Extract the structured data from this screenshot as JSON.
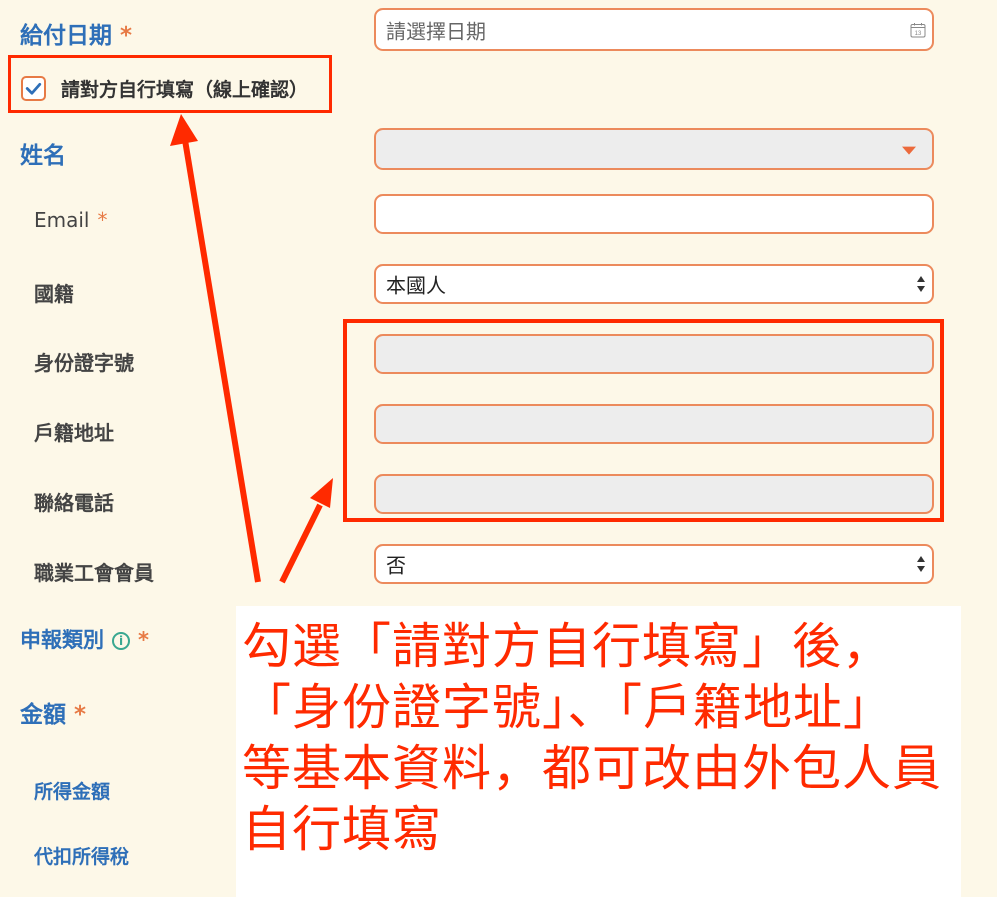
{
  "form": {
    "pay_date": {
      "label": "給付日期",
      "required": "*",
      "placeholder": "請選擇日期",
      "cal_day": "13"
    },
    "self_fill": {
      "label": "請對方自行填寫（線上確認）",
      "checked": true
    },
    "name": {
      "label": "姓名"
    },
    "email": {
      "label": "Email",
      "required": "*"
    },
    "nationality": {
      "label": "國籍",
      "value": "本國人"
    },
    "id_number": {
      "label": "身份證字號"
    },
    "address": {
      "label": "戶籍地址"
    },
    "phone": {
      "label": "聯絡電話"
    },
    "union_member": {
      "label": "職業工會會員",
      "value": "否"
    },
    "report_type": {
      "label": "申報類別",
      "required": "*"
    },
    "amount": {
      "label": "金額",
      "required": "*"
    },
    "income_amount": {
      "label": "所得金額"
    },
    "withholding_tax": {
      "label": "代扣所得稅"
    }
  },
  "annotation": {
    "text": "勾選「請對方自行填寫」後，「身份證字號」、「戶籍地址」等基本資料，都可改由外包人員自行填寫"
  },
  "colors": {
    "label_blue": "#2e6fb8",
    "field_border": "#ec8a5c",
    "annotation_red": "#ff2a00",
    "background": "#fdf8e8"
  }
}
